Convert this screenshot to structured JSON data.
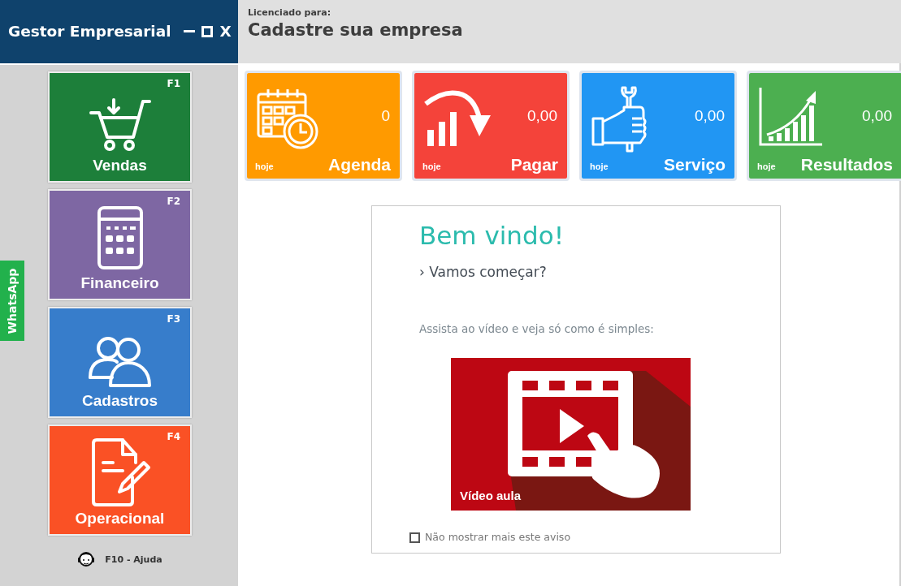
{
  "window": {
    "title": "Gestor Empresarial",
    "close": "X"
  },
  "header": {
    "caption": "Licenciado para:",
    "company": "Cadastre sua empresa"
  },
  "sidebar": {
    "modules": [
      {
        "label": "Vendas",
        "key": "F1",
        "color": "#1d7f3a",
        "kind": "cart"
      },
      {
        "label": "Financeiro",
        "key": "F2",
        "color": "#7e67a3",
        "kind": "calculator"
      },
      {
        "label": "Cadastros",
        "key": "F3",
        "color": "#377dcb",
        "kind": "people"
      },
      {
        "label": "Operacional",
        "key": "F4",
        "color": "#fa5125",
        "kind": "document"
      }
    ],
    "whatsapp": "WhatsApp",
    "help": "F10 - Ajuda"
  },
  "summary_cards": [
    {
      "title": "Agenda",
      "value": "0",
      "period": "hoje",
      "color": "#ff9a00",
      "kind": "calendar"
    },
    {
      "title": "Pagar",
      "value": "0,00",
      "period": "hoje",
      "color": "#f4433a",
      "kind": "payments"
    },
    {
      "title": "Serviço",
      "value": "0,00",
      "period": "hoje",
      "color": "#2196f3",
      "kind": "service"
    },
    {
      "title": "Resultados",
      "value": "0,00",
      "period": "hoje",
      "color": "#4caf50",
      "kind": "results"
    }
  ],
  "welcome": {
    "title": "Bem vindo!",
    "subtitle": "› Vamos começar?",
    "prompt": "Assista ao vídeo e veja só como é simples:",
    "video": {
      "label": "Vídeo aula"
    },
    "dismiss": {
      "label": "Não mostrar mais este aviso",
      "checked": false
    }
  }
}
